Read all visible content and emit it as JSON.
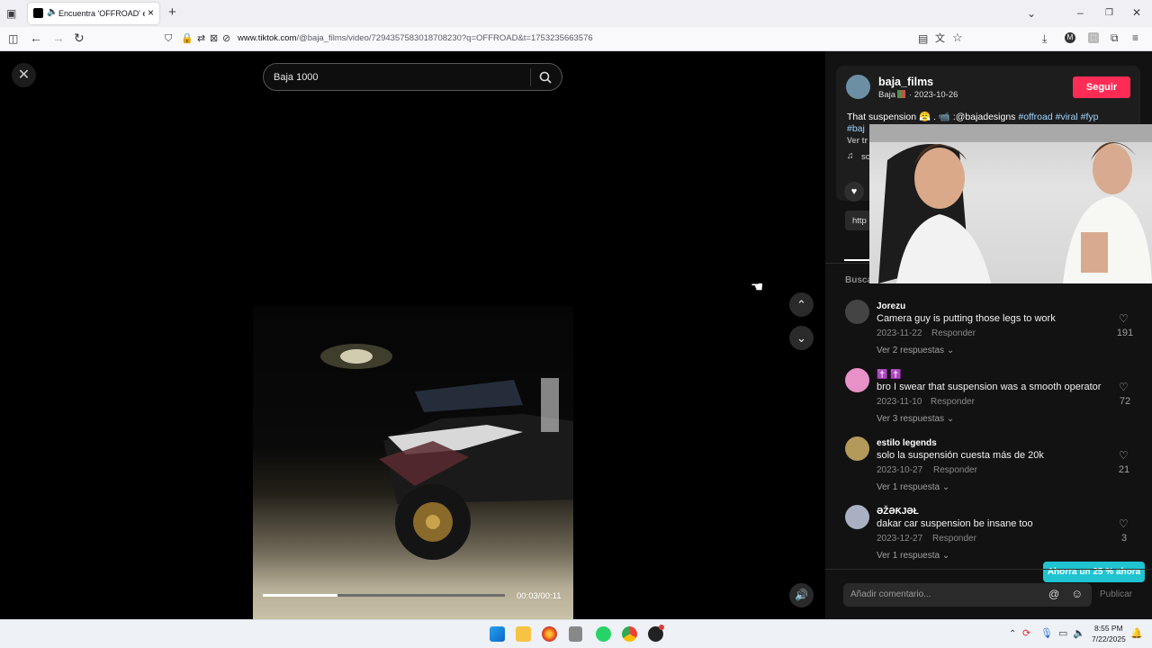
{
  "browser": {
    "tab_title": "Encuentra 'OFFROAD' en Ti",
    "url_domain": "www.tiktok.com",
    "url_path": "/@baja_films/video/7294357583018708230?q=OFFROAD&t=1753235663576"
  },
  "player": {
    "search_value": "Baja 1000",
    "time": "00:03/00:11",
    "progress": 0.31
  },
  "post": {
    "username": "baja_films",
    "subline": "Baja",
    "date": "· 2023-10-26",
    "follow_label": "Seguir",
    "caption": "That suspension",
    "caption_mention": ":@bajadesigns",
    "hashtags": "#offroad #viral #fyp",
    "hashtags_line2": "#baj",
    "translate_snippet": "Ver tr",
    "music_snippet": "sc",
    "link_snippet": "http",
    "search_snippet": "Busca"
  },
  "comments": [
    {
      "user": "Jorezu",
      "text": "Camera guy is putting those legs to work",
      "date": "2023-11-22",
      "reply": "Responder",
      "more": "Ver 2 respuestas",
      "likes": "191"
    },
    {
      "user": "✝️ ✝️",
      "text": "bro I swear that suspension was a smooth operator",
      "date": "2023-11-10",
      "reply": "Responder",
      "more": "Ver 3 respuestas",
      "likes": "72"
    },
    {
      "user": "estilo legends",
      "text": "solo la suspensión cuesta más de 20k",
      "date": "2023-10-27",
      "reply": "Responder",
      "more": "Ver 1 respuesta",
      "likes": "21"
    },
    {
      "user": "ƏŽƏƘJƏŁ",
      "text": "dakar car suspension be insane too",
      "date": "2023-12-27",
      "reply": "Responder",
      "more": "Ver 1 respuesta",
      "likes": "3"
    }
  ],
  "promo": "Ahorra un 25 % ahora",
  "comment_input": {
    "placeholder": "Añadir comentario...",
    "publish": "Publicar"
  },
  "taskbar": {
    "time": "8:55 PM",
    "date": "7/22/2025"
  },
  "colors": {
    "follow": "#fe2c55",
    "promo": "#20c4d0",
    "hashtag": "#9fd6ff"
  }
}
